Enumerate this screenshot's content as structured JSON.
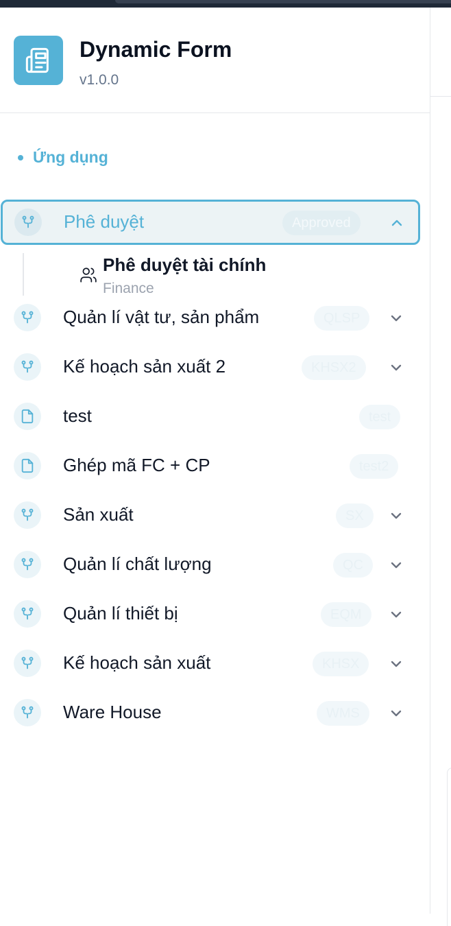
{
  "app": {
    "title": "Dynamic Form",
    "version": "v1.0.0"
  },
  "nav": {
    "section_label": "Ứng dụng",
    "items": [
      {
        "label": "Phê duyệt",
        "badge": "Approved",
        "icon": "git-branch-icon",
        "expanded": true,
        "active": true
      },
      {
        "label": "Quản lí vật tư, sản phẩm",
        "badge": "QLSP",
        "icon": "git-branch-icon",
        "expanded": false
      },
      {
        "label": "Kế hoạch sản xuất 2",
        "badge": "KHSX2",
        "icon": "git-branch-icon",
        "expanded": false
      },
      {
        "label": "test",
        "badge": "test",
        "icon": "file-icon",
        "expanded": null
      },
      {
        "label": "Ghép mã FC + CP",
        "badge": "test2",
        "icon": "file-icon",
        "expanded": null
      },
      {
        "label": "Sản xuất",
        "badge": "SX",
        "icon": "git-branch-icon",
        "expanded": false
      },
      {
        "label": "Quản lí chất lượng",
        "badge": "QC",
        "icon": "git-branch-icon",
        "expanded": false
      },
      {
        "label": "Quản lí thiết bị",
        "badge": "EQM",
        "icon": "git-branch-icon",
        "expanded": false
      },
      {
        "label": "Kế hoạch sản xuất",
        "badge": "KHSX",
        "icon": "git-branch-icon",
        "expanded": false
      },
      {
        "label": "Ware House",
        "badge": "WMS",
        "icon": "git-branch-icon",
        "expanded": false
      }
    ],
    "children": {
      "approval": [
        {
          "title": "Phê duyệt tài chính",
          "subtitle": "Finance",
          "icon": "users-icon"
        }
      ]
    }
  },
  "colors": {
    "accent": "#55b2d6",
    "text": "#111827",
    "muted": "#9ca3af"
  }
}
